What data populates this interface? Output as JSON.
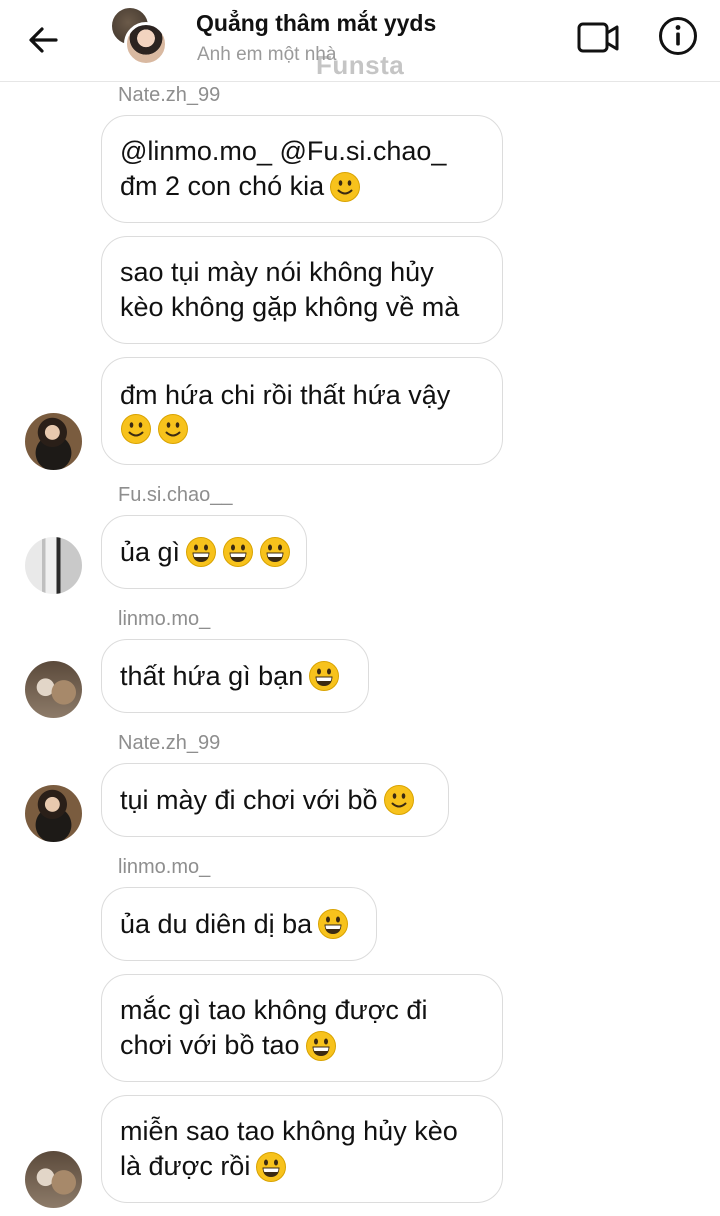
{
  "header": {
    "title": "Quẳng thâm mắt yyds",
    "subtitle": "Anh em một nhà",
    "watermark": "Funsta",
    "back_icon": "arrow-left-icon",
    "video_icon": "video-camera-icon",
    "info_icon": "info-icon"
  },
  "messages": [
    {
      "sender": "Nate.zh_99",
      "lines": [
        [
          "@linmo.mo_ @Fu.si.chao_"
        ],
        [
          "đm 2 con chó kia",
          "slight-smile"
        ]
      ]
    },
    {
      "lines": [
        [
          "sao tụi mày nói không hủy"
        ],
        [
          "kèo không gặp không về mà"
        ]
      ]
    },
    {
      "lines": [
        [
          "đm hứa chi rồi thất hứa vậy"
        ],
        [
          "",
          "slight-smile",
          "slight-smile"
        ]
      ]
    },
    {
      "sender": "Fu.si.chao__",
      "lines": [
        [
          "ủa gì",
          "grin",
          "grin",
          "grin"
        ]
      ]
    },
    {
      "sender": "linmo.mo_",
      "lines": [
        [
          "thất hứa gì bạn",
          "grin"
        ]
      ]
    },
    {
      "sender": "Nate.zh_99",
      "lines": [
        [
          "tụi mày đi chơi với bồ",
          "slight-smile"
        ]
      ]
    },
    {
      "sender": "linmo.mo_",
      "lines": [
        [
          "ủa du diên dị ba",
          "grin"
        ]
      ]
    },
    {
      "lines": [
        [
          "mắc gì tao không được đi"
        ],
        [
          "chơi với bồ tao",
          "grin"
        ]
      ]
    },
    {
      "lines": [
        [
          "miễn sao tao không hủy kèo"
        ],
        [
          "là được rồi",
          "grin"
        ]
      ]
    }
  ],
  "colors": {
    "bubble_border": "#dcdcdc",
    "sender_text": "#8e8e8e",
    "emoji_yellow": "#f7c21c"
  }
}
